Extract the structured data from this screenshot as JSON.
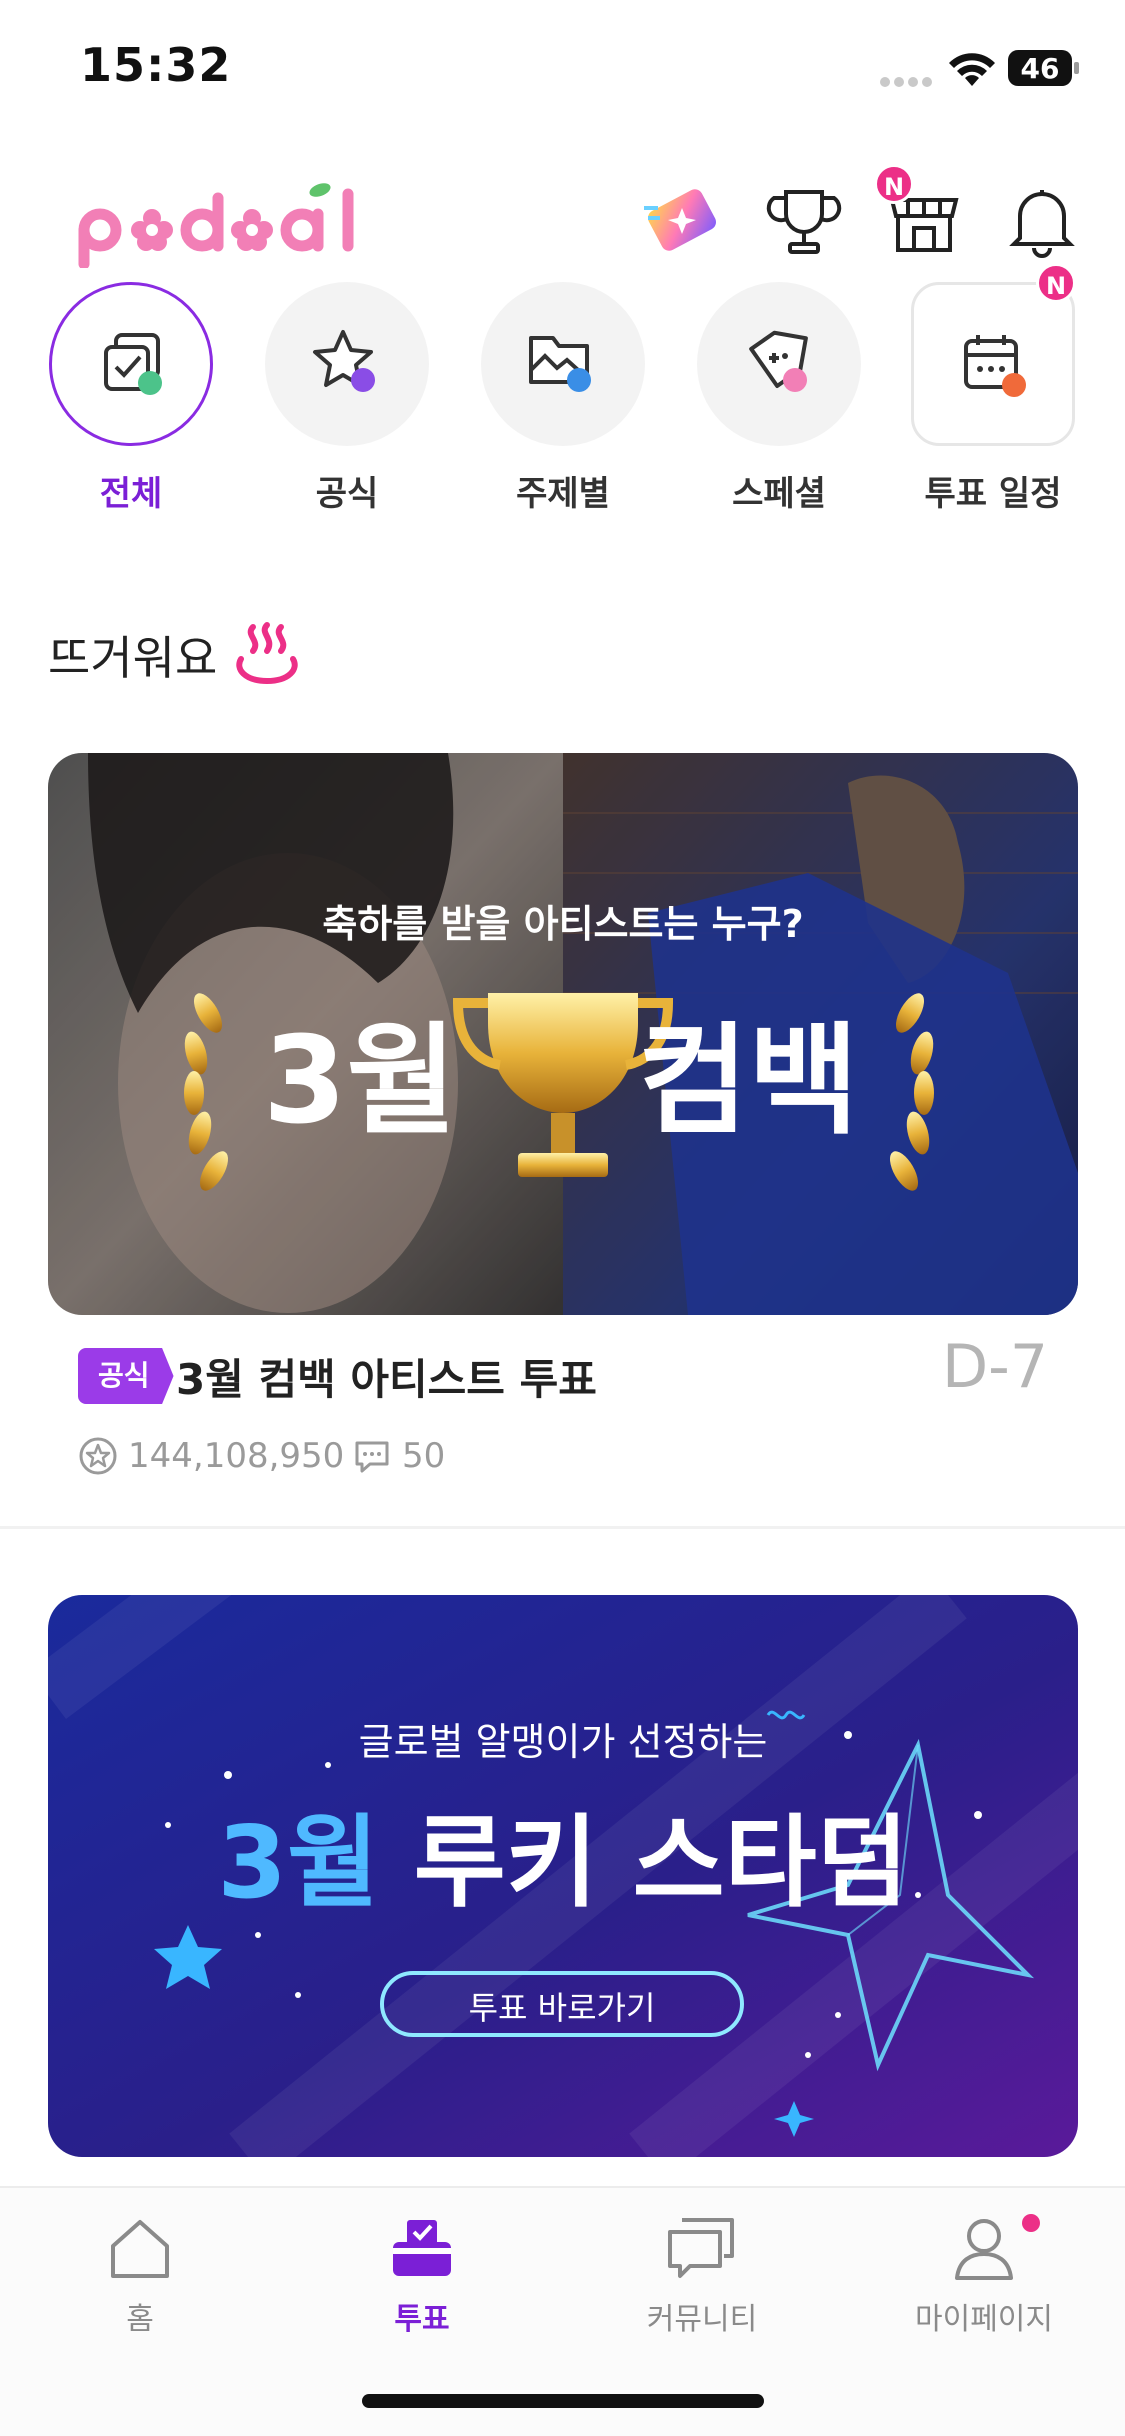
{
  "status_bar": {
    "time": "15:32",
    "battery": "46"
  },
  "header": {
    "logo_text": "podoal",
    "shop_badge": "N"
  },
  "categories": [
    {
      "label": "전체",
      "icon": "check-copy-icon",
      "active": true
    },
    {
      "label": "공식",
      "icon": "star-icon",
      "active": false
    },
    {
      "label": "주제별",
      "icon": "folder-icon",
      "active": false
    },
    {
      "label": "스페셜",
      "icon": "game-tag-icon",
      "active": false
    },
    {
      "label": "투표 일정",
      "icon": "calendar-icon",
      "active": false,
      "badge": "N"
    }
  ],
  "hot_section": {
    "title": "뜨거워요"
  },
  "votes": [
    {
      "banner_subtitle": "축하를 받을 아티스트는 누구?",
      "banner_left": "3월",
      "banner_right": "컴백",
      "tag": "공식",
      "title": "3월 컴백 아티스트 투표",
      "d_day": "D-7",
      "vote_count": "144,108,950",
      "comment_count": "50"
    },
    {
      "banner_subtitle": "글로벌 알맹이가 선정하는",
      "banner_accent": "3월",
      "banner_title": "루키 스타덤",
      "banner_button": "투표 바로가기"
    }
  ],
  "tabs": [
    {
      "label": "홈",
      "icon": "home-icon",
      "active": false
    },
    {
      "label": "투표",
      "icon": "ballot-box-icon",
      "active": true
    },
    {
      "label": "커뮤니티",
      "icon": "chat-icon",
      "active": false
    },
    {
      "label": "마이페이지",
      "icon": "user-icon",
      "active": false,
      "dot": true
    }
  ],
  "colors": {
    "accent": "#7b1fd6",
    "tag": "#9b3be8",
    "badge": "#ec2f87",
    "logo": "#f27fb6"
  }
}
